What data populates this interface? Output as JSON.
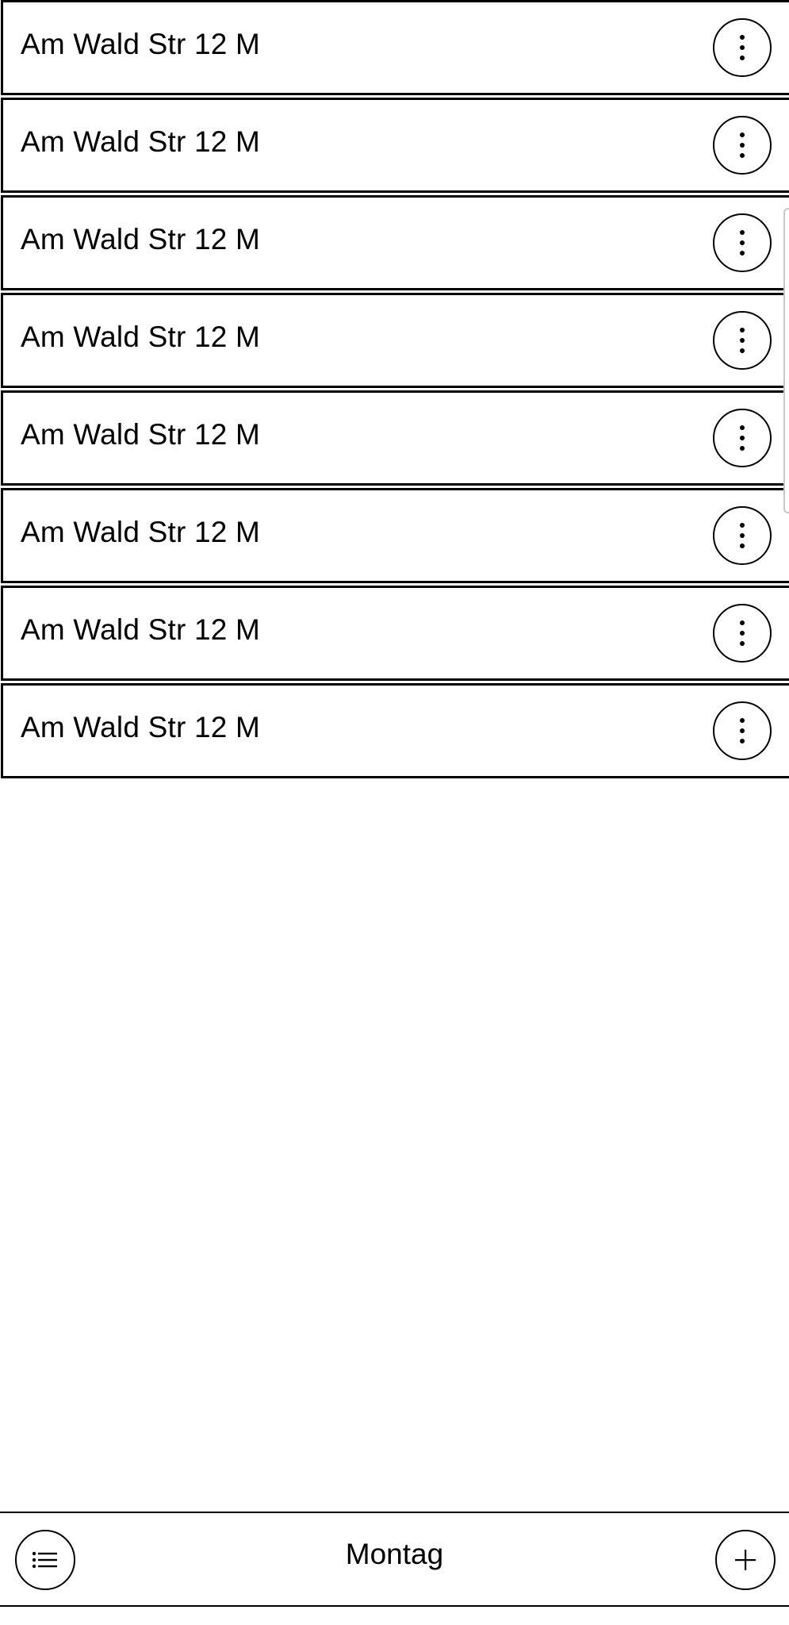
{
  "list": {
    "items": [
      {
        "label": "Am Wald Str 12 M",
        "menu_icon": "more-vertical-icon"
      },
      {
        "label": "Am Wald Str 12 M",
        "menu_icon": "more-vertical-icon"
      },
      {
        "label": "Am Wald Str 12 M",
        "menu_icon": "more-vertical-icon"
      },
      {
        "label": "Am Wald Str 12 M",
        "menu_icon": "more-vertical-icon"
      },
      {
        "label": "Am Wald Str 12 M",
        "menu_icon": "more-vertical-icon"
      },
      {
        "label": "Am Wald Str 12 M",
        "menu_icon": "more-vertical-icon"
      },
      {
        "label": "Am Wald Str 12 M",
        "menu_icon": "more-vertical-icon"
      },
      {
        "label": "Am Wald Str 12 M",
        "menu_icon": "more-vertical-icon"
      }
    ]
  },
  "bottom_bar": {
    "title": "Montag",
    "left_icon": "list-icon",
    "right_icon": "plus-icon"
  },
  "colors": {
    "foreground": "#000000",
    "background": "#ffffff",
    "scroll_indicator": "#c8c8c8"
  }
}
